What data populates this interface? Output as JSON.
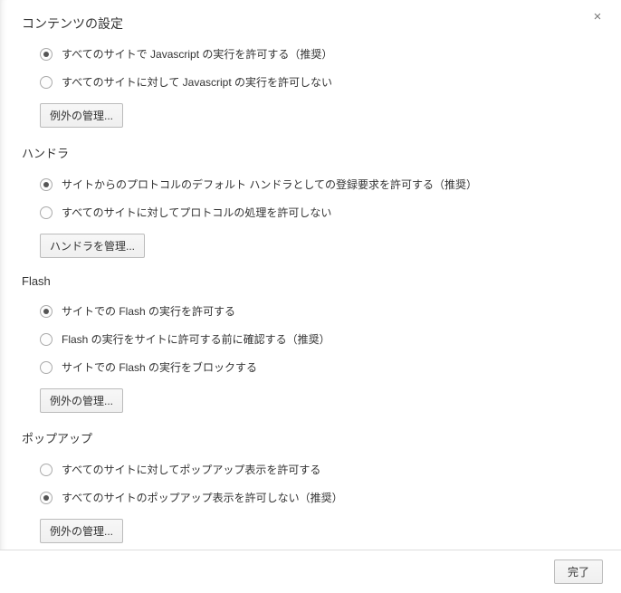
{
  "dialog": {
    "title": "コンテンツの設定",
    "close": "×",
    "done": "完了"
  },
  "sections": {
    "javascript": {
      "options": {
        "allow": "すべてのサイトで Javascript の実行を許可する（推奨）",
        "block": "すべてのサイトに対して Javascript の実行を許可しない"
      },
      "manage": "例外の管理..."
    },
    "handlers": {
      "title": "ハンドラ",
      "options": {
        "allow": "サイトからのプロトコルのデフォルト ハンドラとしての登録要求を許可する（推奨）",
        "block": "すべてのサイトに対してプロトコルの処理を許可しない"
      },
      "manage": "ハンドラを管理..."
    },
    "flash": {
      "title": "Flash",
      "options": {
        "allow": "サイトでの Flash の実行を許可する",
        "ask": "Flash の実行をサイトに許可する前に確認する（推奨）",
        "block": "サイトでの Flash の実行をブロックする"
      },
      "manage": "例外の管理..."
    },
    "popups": {
      "title": "ポップアップ",
      "options": {
        "allow": "すべてのサイトに対してポップアップ表示を許可する",
        "block": "すべてのサイトのポップアップ表示を許可しない（推奨）"
      },
      "manage": "例外の管理..."
    }
  }
}
